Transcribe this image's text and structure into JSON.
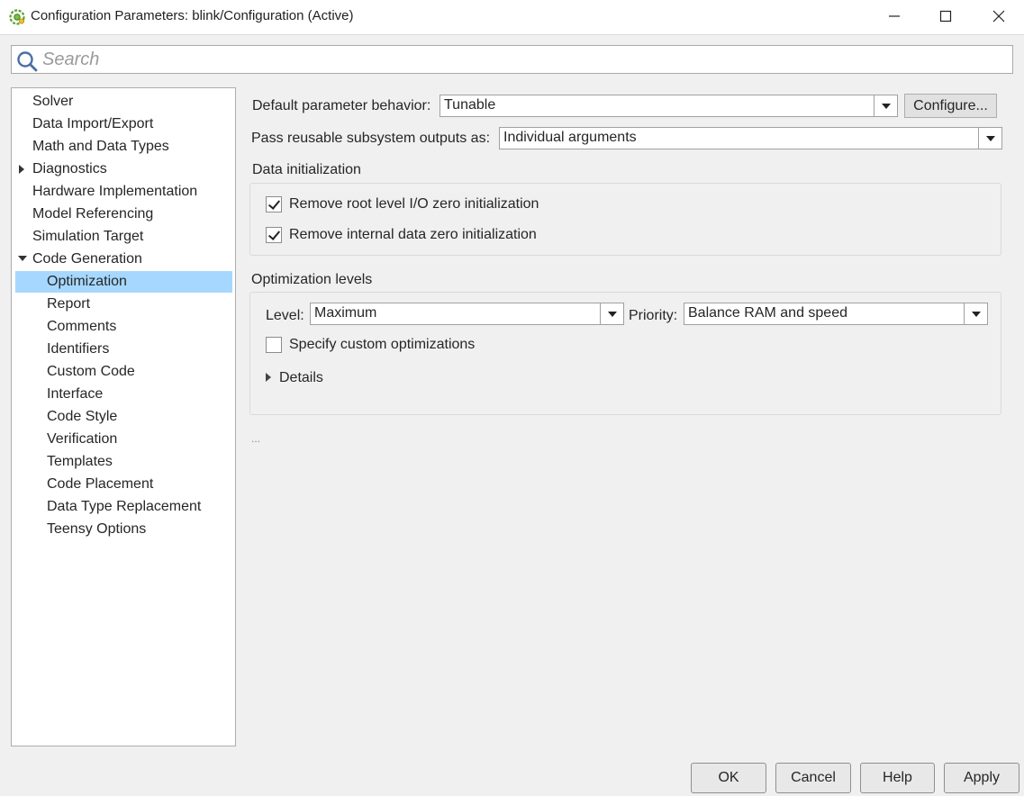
{
  "window": {
    "title": "Configuration Parameters: blink/Configuration (Active)",
    "minimize_glyph": "—",
    "close_glyph": "✕"
  },
  "search": {
    "placeholder": "Search"
  },
  "tree": {
    "items": [
      {
        "label": "Solver"
      },
      {
        "label": "Data Import/Export"
      },
      {
        "label": "Math and Data Types"
      },
      {
        "label": "Diagnostics",
        "expander": "collapsed"
      },
      {
        "label": "Hardware Implementation"
      },
      {
        "label": "Model Referencing"
      },
      {
        "label": "Simulation Target"
      },
      {
        "label": "Code Generation",
        "expander": "expanded"
      },
      {
        "label": "Optimization",
        "selected": true
      },
      {
        "label": "Report"
      },
      {
        "label": "Comments"
      },
      {
        "label": "Identifiers"
      },
      {
        "label": "Custom Code"
      },
      {
        "label": "Interface"
      },
      {
        "label": "Code Style"
      },
      {
        "label": "Verification"
      },
      {
        "label": "Templates"
      },
      {
        "label": "Code Placement"
      },
      {
        "label": "Data Type Replacement"
      },
      {
        "label": "Teensy Options"
      }
    ]
  },
  "panel": {
    "default_param_label": "Default parameter behavior:",
    "default_param_value": "Tunable",
    "configure_button": "Configure...",
    "pass_reusable_label": "Pass reusable subsystem outputs as:",
    "pass_reusable_value": "Individual arguments",
    "data_init": {
      "heading": "Data initialization",
      "remove_root_label": "Remove root level I/O zero initialization",
      "remove_root_checked": true,
      "remove_internal_label": "Remove internal data zero initialization",
      "remove_internal_checked": true
    },
    "opt_levels": {
      "heading": "Optimization levels",
      "level_label": "Level:",
      "level_value": "Maximum",
      "priority_label": "Priority:",
      "priority_value": "Balance RAM and speed",
      "custom_label": "Specify custom optimizations",
      "custom_checked": false,
      "details_label": "Details"
    },
    "ellipsis": "..."
  },
  "buttons": {
    "ok": "OK",
    "cancel": "Cancel",
    "help": "Help",
    "apply": "Apply"
  },
  "colors": {
    "selection": "#a6d8ff",
    "app_icon": "#5aa02c"
  }
}
